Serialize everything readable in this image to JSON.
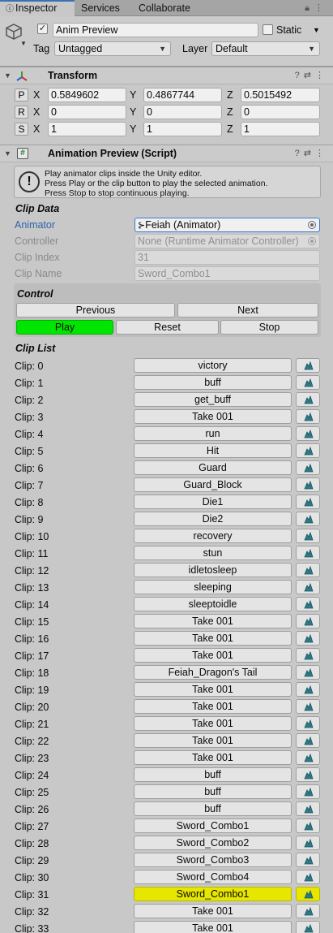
{
  "tabs": [
    {
      "label": "Inspector",
      "active": true
    },
    {
      "label": "Services",
      "active": false
    },
    {
      "label": "Collaborate",
      "active": false
    }
  ],
  "gameobject": {
    "active_checked": true,
    "name": "Anim Preview",
    "static_label": "Static",
    "tag_label": "Tag",
    "tag_value": "Untagged",
    "layer_label": "Layer",
    "layer_value": "Default"
  },
  "transform": {
    "title": "Transform",
    "rows": [
      {
        "btn": "P",
        "x": "0.5849602",
        "y": "0.4867744",
        "z": "0.5015492"
      },
      {
        "btn": "R",
        "x": "0",
        "y": "0",
        "z": "0"
      },
      {
        "btn": "S",
        "x": "1",
        "y": "1",
        "z": "1"
      }
    ],
    "axis_x": "X",
    "axis_y": "Y",
    "axis_z": "Z"
  },
  "script": {
    "title": "Animation Preview (Script)",
    "help_lines": [
      "Play animator clips inside the Unity editor.",
      "Press Play or the clip button to play the selected animation.",
      "Press Stop to stop continuous playing."
    ],
    "clip_data_title": "Clip Data",
    "animator_label": "Animator",
    "animator_value": "Feiah (Animator)",
    "controller_label": "Controller",
    "controller_value": "None (Runtime Animator Controller)",
    "clip_index_label": "Clip Index",
    "clip_index_value": "31",
    "clip_name_label": "Clip Name",
    "clip_name_value": "Sword_Combo1",
    "control_title": "Control",
    "previous_label": "Previous",
    "next_label": "Next",
    "play_label": "Play",
    "reset_label": "Reset",
    "stop_label": "Stop",
    "clip_list_title": "Clip List",
    "selected_clip": 31,
    "clips": [
      "victory",
      "buff",
      "get_buff",
      "Take 001",
      "run",
      "Hit",
      "Guard",
      "Guard_Block",
      "Die1",
      "Die2",
      "recovery",
      "stun",
      "idletosleep",
      "sleeping",
      "sleeptoidle",
      "Take 001",
      "Take 001",
      "Take 001",
      "Feiah_Dragon's Tail",
      "Take 001",
      "Take 001",
      "Take 001",
      "Take 001",
      "Take 001",
      "buff",
      "buff",
      "buff",
      "Sword_Combo1",
      "Sword_Combo2",
      "Sword_Combo3",
      "Sword_Combo4",
      "Sword_Combo1",
      "Take 001",
      "Take 001"
    ],
    "clip_prefix": "Clip: "
  },
  "colors": {
    "play_green": "#00e600",
    "selected_yellow": "#e6e600",
    "link_blue": "#2f62a8"
  }
}
